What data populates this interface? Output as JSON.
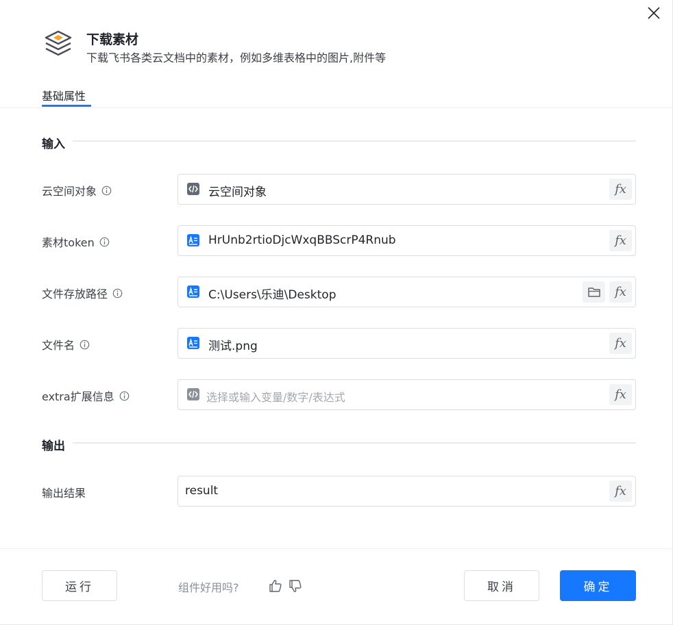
{
  "dialog": {
    "title": "下载素材",
    "description": "下载飞书各类云文档中的素材，例如多维表格中的图片,附件等",
    "tabs": [
      {
        "label": "基础属性",
        "active": true
      }
    ]
  },
  "sections": {
    "input": {
      "title": "输入"
    },
    "output": {
      "title": "输出"
    }
  },
  "fields": [
    {
      "label": "云空间对象",
      "value": "云空间对象",
      "type_icon": "code-icon",
      "placeholder": false,
      "has_info": true
    },
    {
      "label": "素材token",
      "value": "HrUnb2rtioDjcWxqBBScrP4Rnub",
      "type_icon": "text-doc-icon",
      "placeholder": false,
      "has_info": true
    },
    {
      "label": "文件存放路径",
      "value": "C:\\Users\\乐迪\\Desktop",
      "type_icon": "text-doc-icon",
      "placeholder": false,
      "has_info": true,
      "has_folder": true
    },
    {
      "label": "文件名",
      "value": "测试.png",
      "type_icon": "text-doc-icon",
      "placeholder": false,
      "has_info": true
    },
    {
      "label": "extra扩展信息",
      "value": "选择或输入变量/数字/表达式",
      "type_icon": "code-icon",
      "placeholder": true,
      "has_info": true
    }
  ],
  "output_field": {
    "label": "输出结果",
    "value": "result"
  },
  "fx_label": "fx",
  "footer": {
    "run_label": "运行",
    "feedback_text": "组件好用吗?",
    "cancel_label": "取消",
    "ok_label": "确定"
  },
  "colors": {
    "accent": "#1677ff",
    "text_primary": "#1f2329",
    "text_secondary": "#3b3f46",
    "placeholder": "#a3a8b0",
    "border": "#dcdee3"
  }
}
